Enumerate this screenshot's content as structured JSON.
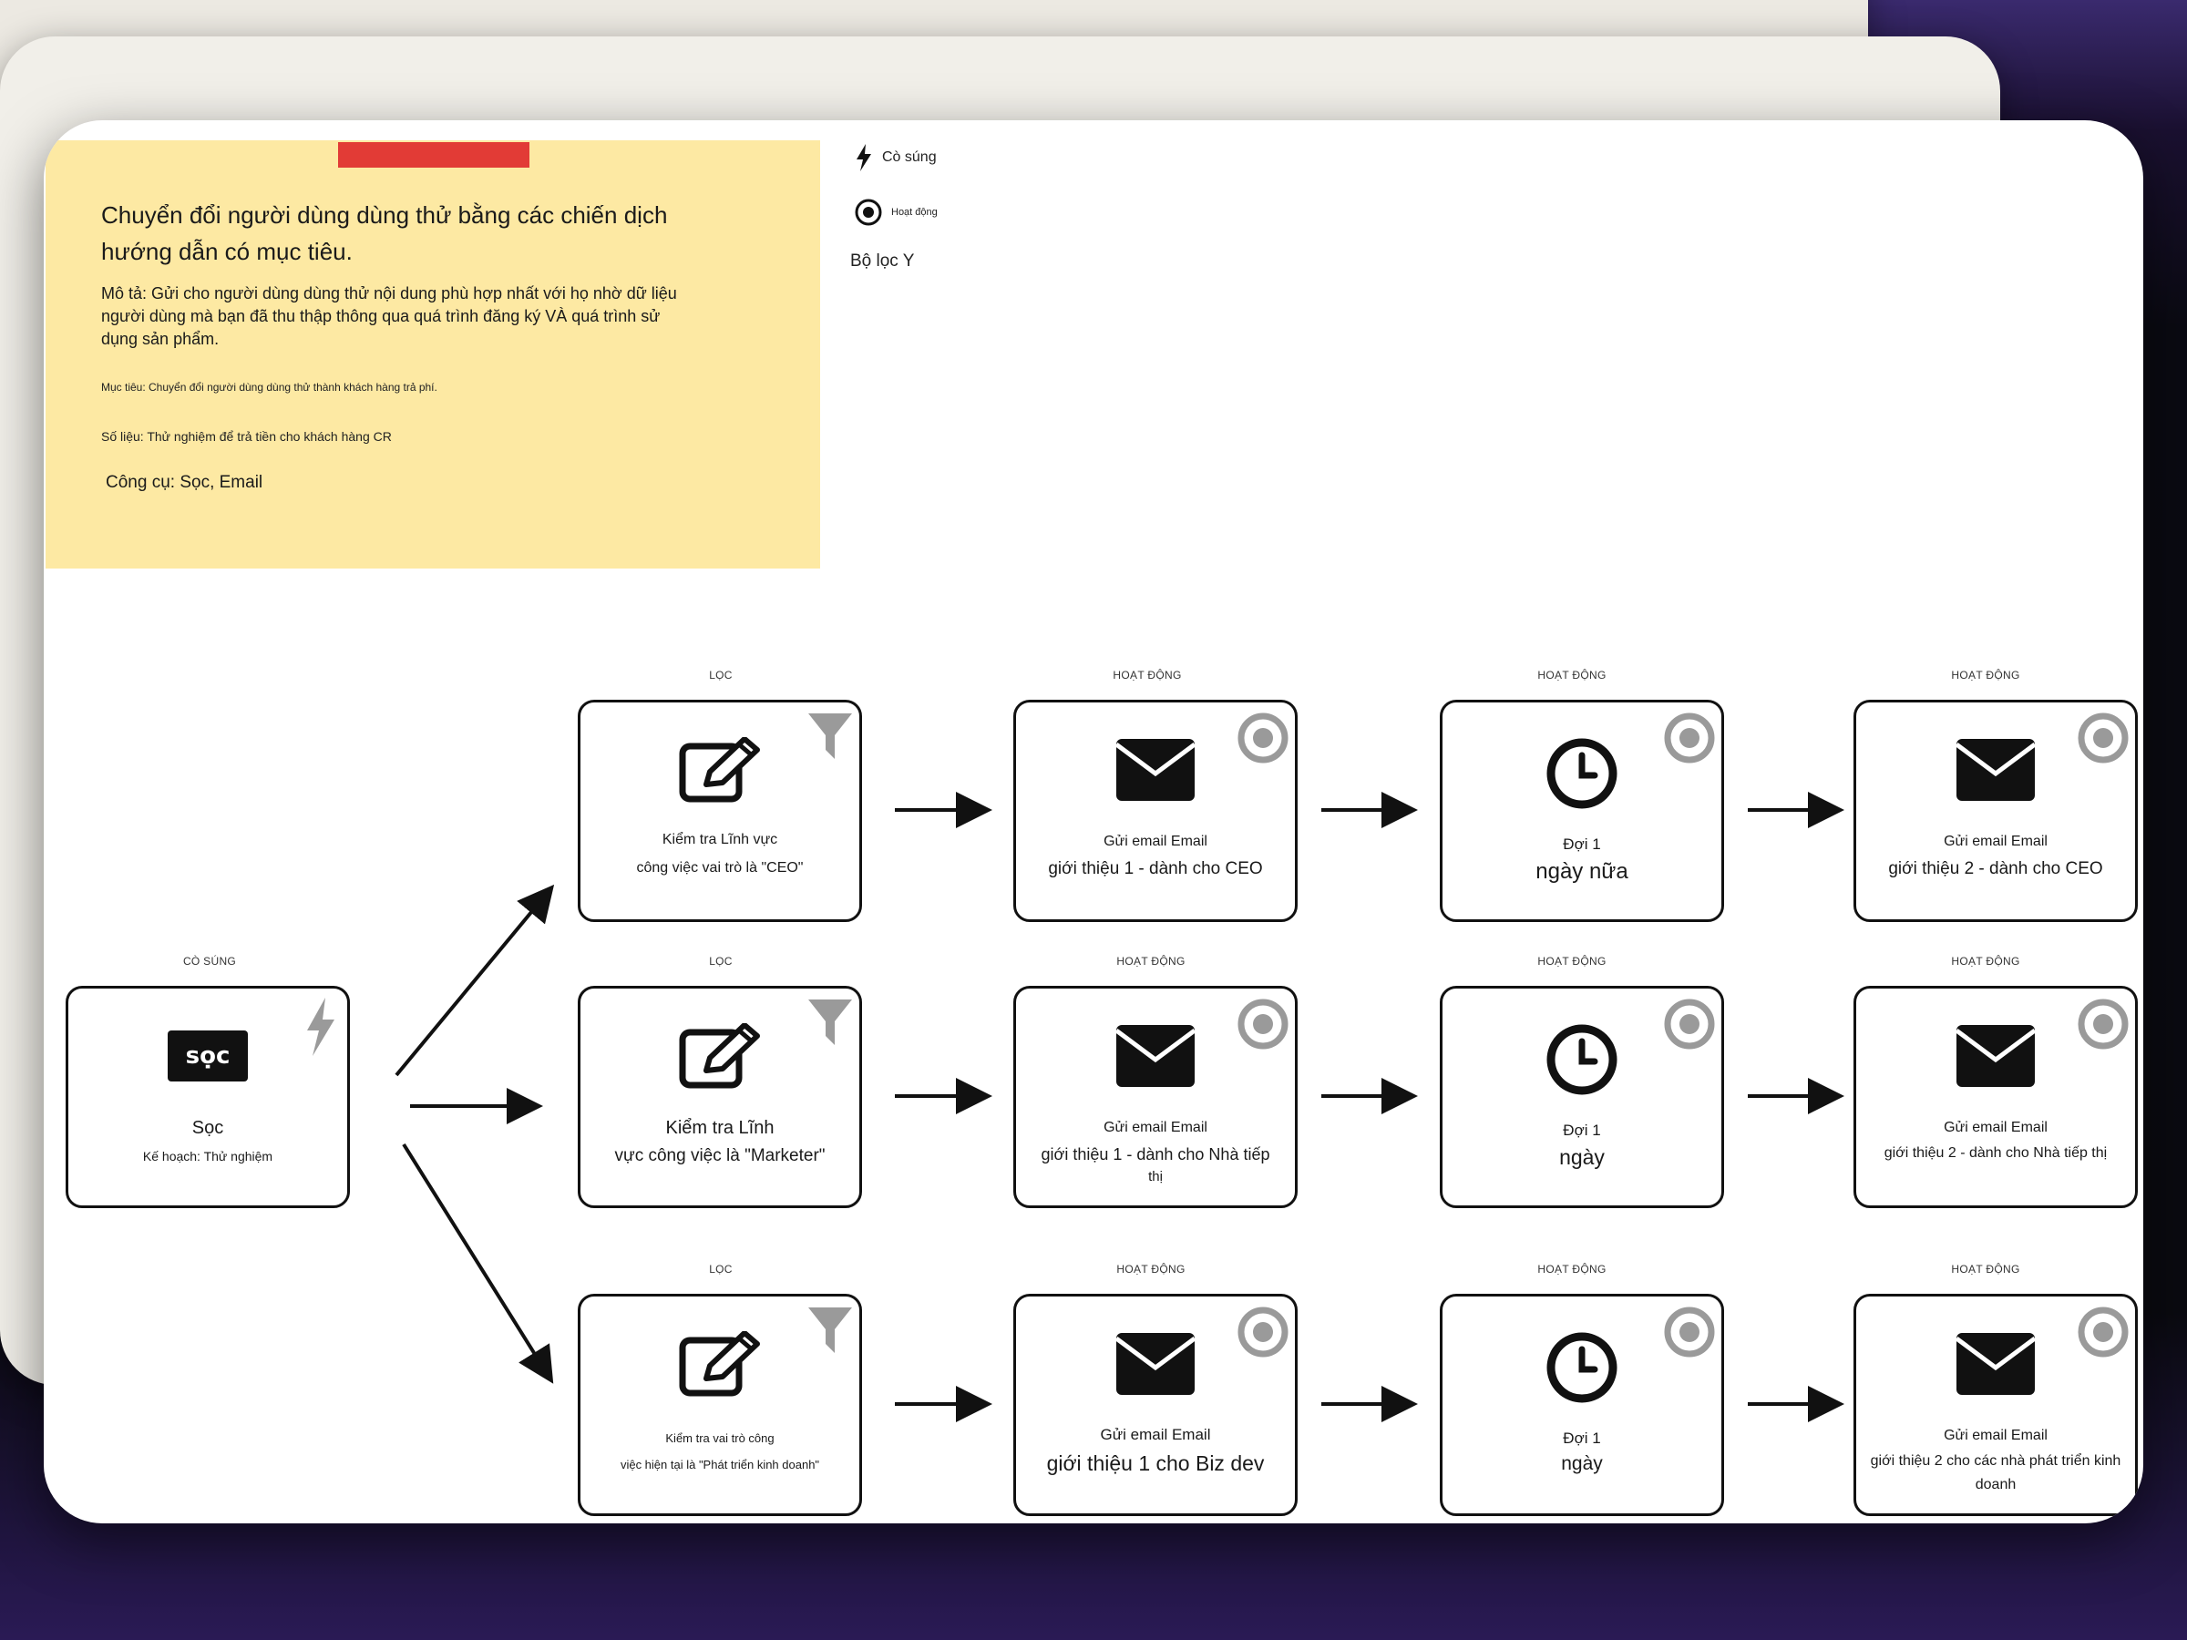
{
  "sticky": {
    "title": "Chuyển đổi người dùng dùng thử bằng các chiến dịch hướng dẫn có mục tiêu.",
    "description": "Mô tả: Gửi cho người dùng dùng thử nội dung phù hợp nhất với họ nhờ dữ liệu người dùng mà bạn đã thu thập thông qua quá trình đăng ký VÀ quá trình sử dụng sản phẩm.",
    "goal": "Mục tiêu: Chuyển đổi người dùng dùng thử thành khách hàng trả phí.",
    "metric": "Số liệu: Thử nghiệm để trả tiền cho khách hàng CR",
    "tools": "Công cụ: Sọc, Email"
  },
  "legend": {
    "trigger": "Cò súng",
    "action": "Hoạt động",
    "filter": "Bộ lọc Y"
  },
  "labels": {
    "trigger": "CÒ SÚNG",
    "filter": "LỌC",
    "action": "HOẠT ĐỘNG"
  },
  "trigger_node": {
    "logo_text": "sọc",
    "title": "Sọc",
    "subtitle": "Kế hoạch: Thử nghiệm"
  },
  "rows": [
    {
      "filter": {
        "line1": "Kiểm tra Lĩnh vực",
        "line2": "công việc vai trò là \"CEO\""
      },
      "email1": {
        "line1": "Gửi email Email",
        "line2": "giới thiệu 1 - dành cho CEO"
      },
      "wait": {
        "line1": "Đợi 1",
        "line2": "ngày nữa"
      },
      "email2": {
        "line1": "Gửi email Email",
        "line2": "giới thiệu 2 - dành cho CEO"
      }
    },
    {
      "filter": {
        "line1": "Kiểm tra Lĩnh",
        "line2": "vực công việc là \"Marketer\""
      },
      "email1": {
        "line1": "Gửi email Email",
        "line2": "giới thiệu 1 - dành cho Nhà tiếp",
        "line3": "thị"
      },
      "wait": {
        "line1": "Đợi 1",
        "line2": "ngày"
      },
      "email2": {
        "line1": "Gửi email Email",
        "line2": "giới thiệu 2 - dành cho Nhà tiếp thị"
      }
    },
    {
      "filter": {
        "line1": "Kiểm tra vai trò công",
        "line2": "việc hiện tại là \"Phát triển kinh doanh\""
      },
      "email1": {
        "line1": "Gửi email Email",
        "line2": "giới thiệu 1 cho Biz dev"
      },
      "wait": {
        "line1": "Đợi 1",
        "line2": "ngày"
      },
      "email2": {
        "line1": "Gửi email Email",
        "line2": "giới thiệu 2 cho các nhà phát triển kinh",
        "line3": "doanh"
      }
    }
  ],
  "colors": {
    "tape": "#e23b36",
    "sticky": "#fde9a3",
    "badge": "#999999"
  }
}
